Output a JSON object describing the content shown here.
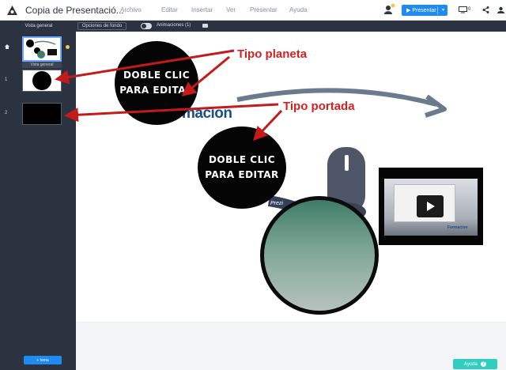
{
  "app": {
    "title": "Copia de Presentació..."
  },
  "menu": [
    "Archivo",
    "Editar",
    "Insertar",
    "Ver",
    "Presentar",
    "Ayuda"
  ],
  "toolbar": {
    "present_label": "Presentar",
    "screen_count": "0"
  },
  "toolbar2": {
    "overview_label": "Vista general",
    "background_label": "Opciones de fondo",
    "animations_label": "Animaciones (1)"
  },
  "sidebar": {
    "overview_label": "Vista general",
    "slides": [
      {
        "number": "1"
      },
      {
        "number": "2"
      }
    ],
    "add_topic_label": "+ tema"
  },
  "canvas": {
    "topic_planet_text": [
      "DOBLE CLIC",
      "PARA EDITAR"
    ],
    "topic_cover_text": [
      "DOBLE CLIC",
      "PARA EDITAR"
    ],
    "annotation_planet": "Tipo planeta",
    "annotation_cover": "Tipo portada",
    "brand_text": "ormacion",
    "path_text": "Prezi",
    "laptop_brand": "Formacion"
  },
  "help": {
    "label": "Ayuda"
  },
  "colors": {
    "accent": "#1f8bf0",
    "sidebar": "#2b3341",
    "annotation": "#d81f1f",
    "help": "#2ecfc0"
  }
}
